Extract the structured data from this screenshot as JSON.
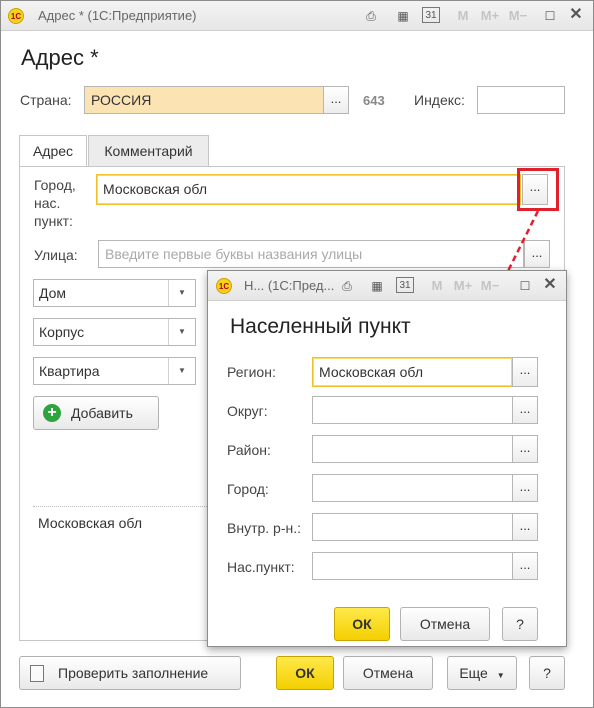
{
  "main_window": {
    "title": "Адрес * (1С:Предприятие)",
    "heading": "Адрес *",
    "country_label": "Страна:",
    "country_value": "РОССИЯ",
    "country_code": "643",
    "index_label": "Индекс:",
    "index_value": "",
    "tabs": [
      "Адрес",
      "Комментарий"
    ],
    "city_label": "Город,\nнас.\nпункт:",
    "city_value": "Московская обл",
    "street_label": "Улица:",
    "street_placeholder": "Введите первые буквы названия улицы",
    "house_options": [
      "Дом",
      "Корпус",
      "Квартира"
    ],
    "add_button": "Добавить",
    "result_text": "Московская обл",
    "check_button": "Проверить заполнение",
    "ok_button": "ОК",
    "cancel_button": "Отмена",
    "more_button": "Еще",
    "help_button": "?",
    "pick_label": "..."
  },
  "titlebar_icons": [
    "logo-icon",
    "print-icon",
    "calculator-icon",
    "calendar-icon",
    "memory-m-icon",
    "memory-plus-icon",
    "memory-minus-icon",
    "maximize-icon",
    "close-icon"
  ],
  "titlebar_text": {
    "logo": "1С",
    "calendar": "31",
    "m": "M",
    "mplus": "M+",
    "mminus": "M−"
  },
  "dialog": {
    "title": "Н... (1С:Пред...",
    "heading": "Населенный пункт",
    "fields": [
      {
        "label": "Регион:",
        "value": "Московская обл"
      },
      {
        "label": "Округ:",
        "value": ""
      },
      {
        "label": "Район:",
        "value": ""
      },
      {
        "label": "Город:",
        "value": ""
      },
      {
        "label": "Внутр. р-н.:",
        "value": ""
      },
      {
        "label": "Нас.пункт:",
        "value": ""
      }
    ],
    "ok_button": "ОК",
    "cancel_button": "Отмена",
    "help_button": "?"
  },
  "colors": {
    "accent_yellow": "#f3cf00",
    "highlight_red": "#e0202a",
    "field_yellow": "#fbe3b4"
  }
}
